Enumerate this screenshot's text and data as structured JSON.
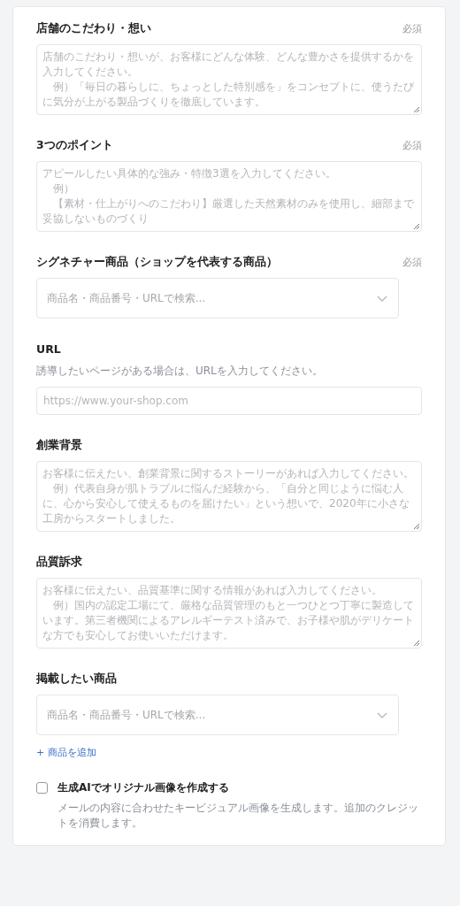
{
  "fields": [
    {
      "kind": "textarea",
      "label": "店舗のこだわり・想い",
      "required": "必須",
      "placeholder": [
        "店舗のこだわり・想いが、お客様にどんな体験、どんな豊かさを提供するかを入力してください。",
        "例）「毎日の暮らしに、ちょっとした特別感を」をコンセプトに、使うたびに気分が上がる製品づくりを徹底しています。"
      ]
    },
    {
      "kind": "textarea",
      "label": "3つのポイント",
      "required": "必須",
      "placeholder": [
        "アピールしたい具体的な強み・特徴3選を入力してください。",
        "例）",
        "【素材・仕上がりへのこだわり】厳選した天然素材のみを使用し、細部まで妥協しないものづくり"
      ]
    },
    {
      "kind": "select",
      "label": "シグネチャー商品（ショップを代表する商品）",
      "required": "必須",
      "placeholder": "商品名・商品番号・URLで検索..."
    },
    {
      "kind": "text",
      "label": "URL",
      "help": "誘導したいページがある場合は、URLを入力してください。",
      "placeholder": "https://www.your-shop.com"
    },
    {
      "kind": "textarea",
      "label": "創業背景",
      "placeholder": [
        "お客様に伝えたい、創業背景に関するストーリーがあれば入力してください。",
        "例）代表自身が肌トラブルに悩んだ経験から、「自分と同じように悩む人に、心から安心して使えるものを届けたい」という想いで、2020年に小さな工房からスタートしました。"
      ]
    },
    {
      "kind": "textarea",
      "label": "品質訴求",
      "placeholder": [
        "お客様に伝えたい、品質基準に関する情報があれば入力してください。",
        "例）国内の認定工場にて、厳格な品質管理のもと一つひとつ丁寧に製造しています。第三者機関によるアレルギーテスト済みで、お子様や肌がデリケートな方でも安心してお使いいただけます。"
      ]
    },
    {
      "kind": "select",
      "label": "掲載したい商品",
      "placeholder": "商品名・商品番号・URLで検索...",
      "add_link": "+ 商品を追加"
    }
  ],
  "ai_image": {
    "label": "生成AIでオリジナル画像を作成する",
    "checked": false,
    "description": "メールの内容に合わせたキービジュアル画像を生成します。追加のクレジットを消費します。"
  }
}
